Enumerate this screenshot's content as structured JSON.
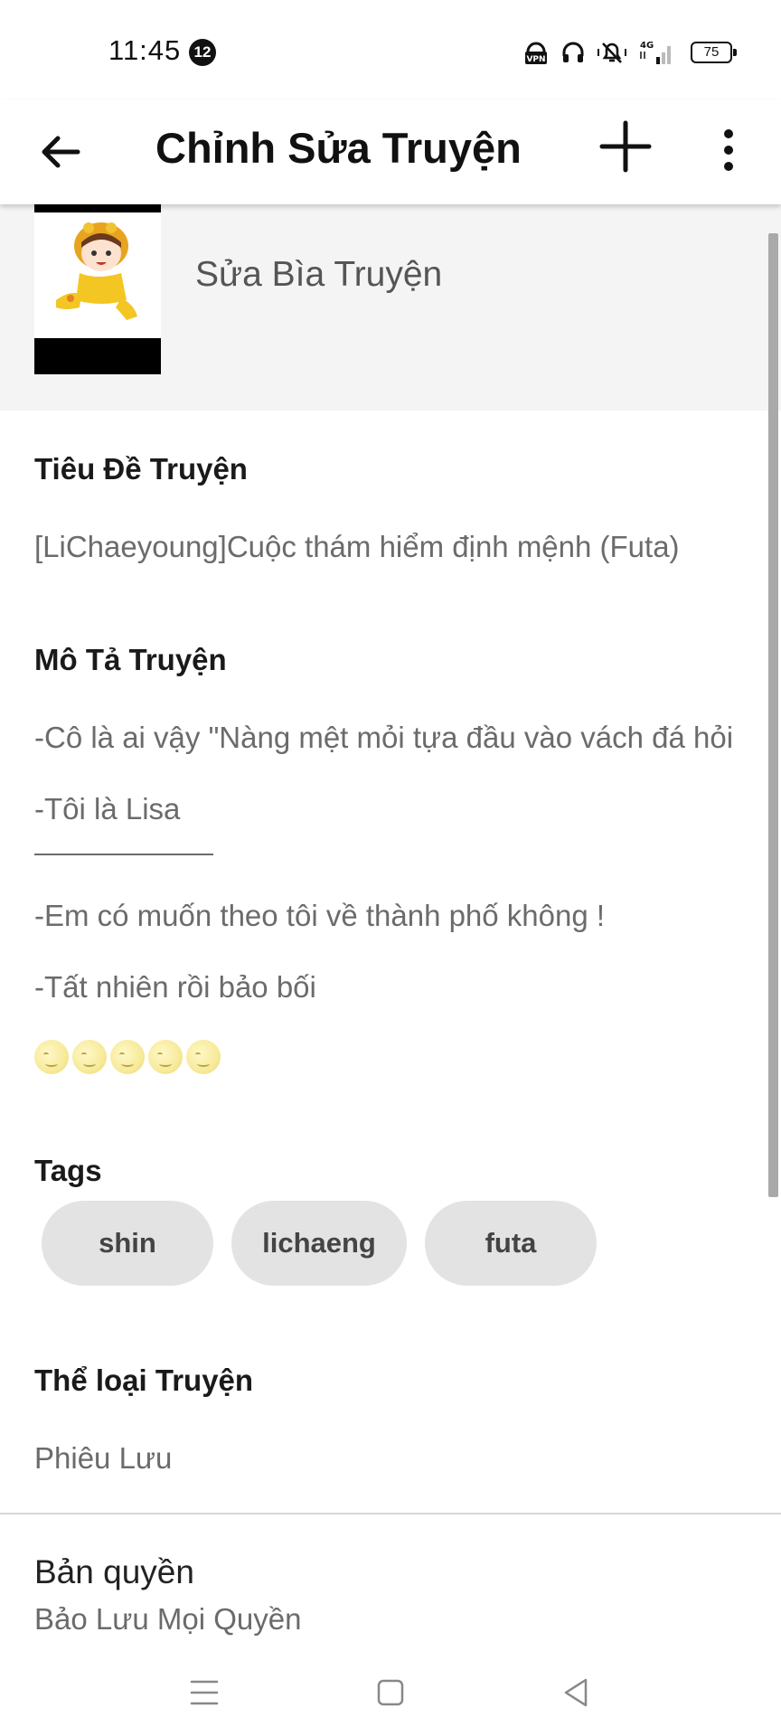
{
  "status_bar": {
    "time": "11:45",
    "notification_count": "12",
    "network": "4G",
    "battery": "75"
  },
  "app_bar": {
    "title": "Chỉnh Sửa Truyện",
    "back_icon": "arrow-left-icon",
    "add_icon": "plus-icon",
    "more_icon": "more-vertical-icon"
  },
  "cover": {
    "label": "Sửa Bìa Truyện"
  },
  "story_title": {
    "heading": "Tiêu Đề Truyện",
    "value": "[LiChaeyoung]Cuộc thám hiểm định mệnh (Futa)"
  },
  "description": {
    "heading": "Mô Tả Truyện",
    "lines": [
      "-Cô là ai vậy \"Nàng mệt mỏi tựa đầu vào vách đá hỏi",
      "-Tôi là Lisa",
      "-Em có muốn theo tôi về thành phố không !",
      "-Tất nhiên rồi bảo bối"
    ],
    "emoji": "moon-face-icon"
  },
  "tags": {
    "heading": "Tags",
    "items": [
      "shin",
      "lichaeng",
      "futa"
    ]
  },
  "genre": {
    "heading": "Thể loại Truyện",
    "value": "Phiêu Lưu"
  },
  "license": {
    "title": "Bản quyền",
    "value": "Bảo Lưu Mọi Quyền"
  },
  "colors": {
    "background": "#ffffff",
    "cover_background": "#f4f4f4",
    "tag_background": "#e3e3e3",
    "secondary_text": "#6b6b6b"
  }
}
